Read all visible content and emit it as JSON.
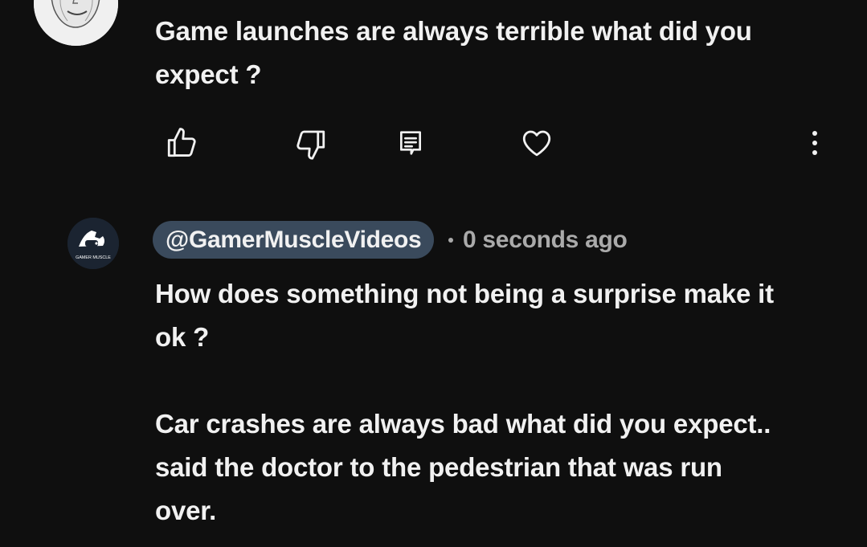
{
  "comment_1": {
    "text": "Game launches are always terrible what did you\nexpect ?",
    "actions": {
      "like_icon": "thumbs-up-icon",
      "dislike_icon": "thumbs-down-icon",
      "reply_icon": "reply-icon",
      "heart_icon": "heart-icon",
      "more_icon": "more-vert-icon"
    }
  },
  "comment_2": {
    "author": "@GamerMuscleVideos",
    "timestamp": "0 seconds ago",
    "avatar_caption": "GAMER MUSCLE",
    "text": "How does something not being a surprise make it\nok ?\n\nCar crashes are always bad what did you expect..\nsaid the doctor to the pedestrian that was run\nover."
  },
  "colors": {
    "background": "#0f0f0f",
    "text_primary": "#f1f1f1",
    "text_secondary": "#aaaaaa",
    "author_chip": "#3a4a5c"
  }
}
